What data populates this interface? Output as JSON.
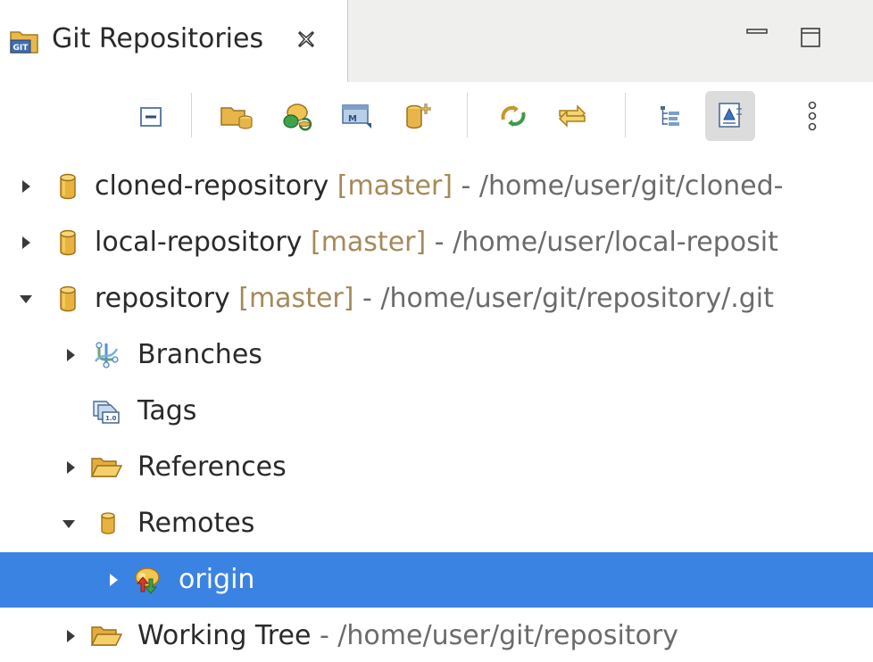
{
  "tab": {
    "title": "Git Repositories",
    "icon": "git-repositories-icon",
    "close_icon": "close-icon"
  },
  "window_controls": {
    "minimize_icon": "minimize-icon",
    "maximize_icon": "maximize-icon"
  },
  "toolbar": {
    "buttons": [
      {
        "name": "collapse-all-button",
        "icon": "collapse-all-icon"
      },
      {
        "name": "add-existing-repository-button",
        "icon": "folder-git-icon"
      },
      {
        "name": "clone-repository-button",
        "icon": "clone-repository-icon"
      },
      {
        "name": "import-projects-button",
        "icon": "import-icon"
      },
      {
        "name": "create-repository-button",
        "icon": "new-repository-icon"
      },
      {
        "name": "refresh-button",
        "icon": "refresh-icon"
      },
      {
        "name": "link-with-selection-button",
        "icon": "link-with-selection-icon"
      },
      {
        "name": "hierarchical-branch-layout-button",
        "icon": "hierarchy-icon"
      },
      {
        "name": "show-representation-button",
        "icon": "representation-icon",
        "pressed": true
      },
      {
        "name": "view-menu-button",
        "icon": "more-vertical-icon"
      }
    ]
  },
  "tree": {
    "rows": [
      {
        "name": "cloned-repository",
        "label": "cloned-repository",
        "branch": "[master]",
        "path": " - /home/user/git/cloned-",
        "expanded": false,
        "icon": "repository-icon"
      },
      {
        "name": "local-repository",
        "label": "local-repository",
        "branch": "[master]",
        "path": " - /home/user/local-reposit",
        "expanded": false,
        "icon": "repository-icon"
      },
      {
        "name": "repository",
        "label": "repository",
        "branch": "[master]",
        "path": " - /home/user/git/repository/.git",
        "expanded": true,
        "icon": "repository-icon"
      },
      {
        "name": "branches",
        "label": "Branches",
        "expanded": false,
        "icon": "branches-icon"
      },
      {
        "name": "tags",
        "label": "Tags",
        "icon": "tags-icon"
      },
      {
        "name": "references",
        "label": "References",
        "expanded": false,
        "icon": "folder-icon"
      },
      {
        "name": "remotes",
        "label": "Remotes",
        "expanded": true,
        "icon": "remotes-icon"
      },
      {
        "name": "origin",
        "label": "origin",
        "expanded": false,
        "selected": true,
        "icon": "remote-origin-icon"
      },
      {
        "name": "working-tree",
        "label": "Working Tree",
        "path": " - /home/user/git/repository",
        "expanded": false,
        "icon": "folder-icon"
      }
    ]
  },
  "colors": {
    "selection": "#3b83e3",
    "branch_text": "#a58a5a",
    "path_text": "#6b6b6b",
    "tab_strip": "#efefee"
  }
}
